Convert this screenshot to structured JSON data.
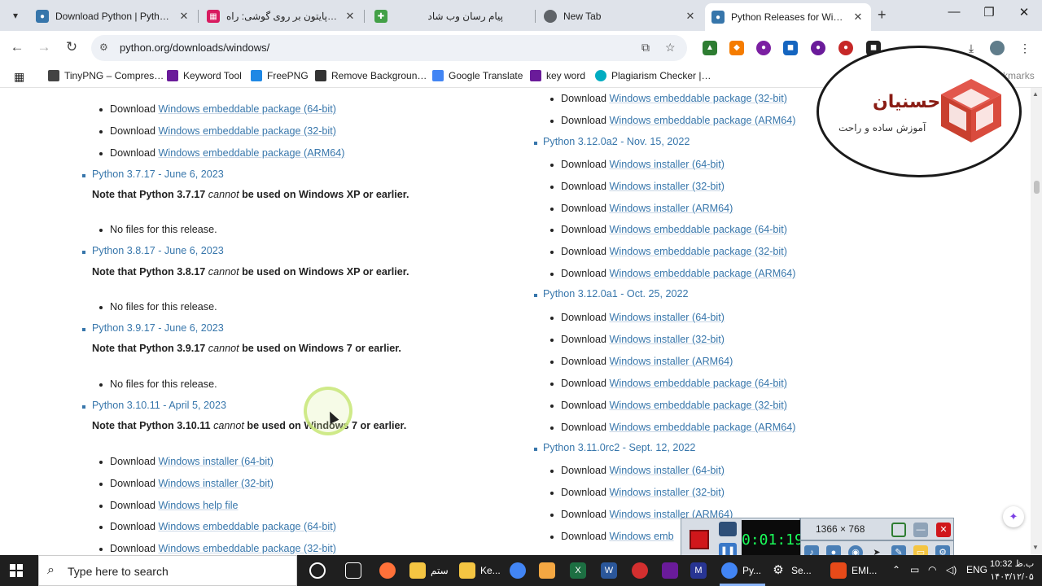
{
  "tabs": [
    {
      "title": "Download Python | Python.o",
      "icon": "python-icon",
      "color": "#3776ab"
    },
    {
      "title": "نصب پایتون بر روی گوشی: راه",
      "icon": "app-icon",
      "color": "#d81b60"
    },
    {
      "title": "",
      "icon": "game-icon",
      "color": "#43a047"
    },
    {
      "title": "پیام رسان وب شاد",
      "icon": "shad-icon",
      "color": "#fff"
    },
    {
      "title": "New Tab",
      "icon": "chrome-icon",
      "color": "#5f6368"
    },
    {
      "title": "Python Releases for Windo",
      "icon": "python-icon",
      "color": "#3776ab"
    }
  ],
  "toolbar": {
    "url": "python.org/downloads/windows/"
  },
  "bookmarks": [
    {
      "label": "TinyPNG – Compres…",
      "icon": "tinypng-icon",
      "color": "#444"
    },
    {
      "label": "Keyword Tool",
      "icon": "keyword-tool-icon",
      "color": "#6a1b9a"
    },
    {
      "label": "FreePNG",
      "icon": "freepng-icon",
      "color": "#1e88e5"
    },
    {
      "label": "Remove Backgroun…",
      "icon": "remove-bg-icon",
      "color": "#333"
    },
    {
      "label": "Google Translate",
      "icon": "translate-icon",
      "color": "#4285f4"
    },
    {
      "label": "key word",
      "icon": "keyword-icon",
      "color": "#6a1b9a"
    },
    {
      "label": "Plagiarism Checker |…",
      "icon": "plagiarism-icon",
      "color": "#00acc1"
    },
    {
      "label": "All Bookmarks",
      "icon": "folder-icon",
      "color": "#777"
    }
  ],
  "left_column": {
    "top_links": [
      {
        "prefix": "Download",
        "link": "Windows embeddable package (64-bit)"
      },
      {
        "prefix": "Download",
        "link": "Windows embeddable package (32-bit)"
      },
      {
        "prefix": "Download",
        "link": "Windows embeddable package (ARM64)"
      }
    ],
    "releases": [
      {
        "title": "Python 3.7.17 - June 6, 2023",
        "note_pre": "Note that Python 3.7.17 ",
        "note_em": "cannot",
        "note_post": " be used on Windows XP or earlier.",
        "files": "No files for this release."
      },
      {
        "title": "Python 3.8.17 - June 6, 2023",
        "note_pre": "Note that Python 3.8.17 ",
        "note_em": "cannot",
        "note_post": " be used on Windows XP or earlier.",
        "files": "No files for this release."
      },
      {
        "title": "Python 3.9.17 - June 6, 2023",
        "note_pre": "Note that Python 3.9.17 ",
        "note_em": "cannot",
        "note_post": " be used on Windows 7 or earlier.",
        "files": "No files for this release."
      },
      {
        "title": "Python 3.10.11 - April 5, 2023",
        "note_pre": "Note that Python 3.10.11 ",
        "note_em": "cannot",
        "note_post": " be used on Windows 7 or earlier.",
        "files": ""
      }
    ],
    "bottom_links": [
      {
        "prefix": "Download",
        "link": "Windows installer (64-bit)"
      },
      {
        "prefix": "Download",
        "link": "Windows installer (32-bit)"
      },
      {
        "prefix": "Download",
        "link": "Windows help file"
      },
      {
        "prefix": "Download",
        "link": "Windows embeddable package (64-bit)"
      },
      {
        "prefix": "Download",
        "link": "Windows embeddable package (32-bit)"
      }
    ]
  },
  "right_column": {
    "top_links": [
      {
        "prefix": "Download",
        "link": "Windows embeddable package (32-bit)"
      },
      {
        "prefix": "Download",
        "link": "Windows embeddable package (ARM64)"
      }
    ],
    "release_a": "Python 3.12.0a2 - Nov. 15, 2022",
    "links_a": [
      {
        "prefix": "Download",
        "link": "Windows installer (64-bit)"
      },
      {
        "prefix": "Download",
        "link": "Windows installer (32-bit)"
      },
      {
        "prefix": "Download",
        "link": "Windows installer (ARM64)"
      },
      {
        "prefix": "Download",
        "link": "Windows embeddable package (64-bit)"
      },
      {
        "prefix": "Download",
        "link": "Windows embeddable package (32-bit)"
      },
      {
        "prefix": "Download",
        "link": "Windows embeddable package (ARM64)"
      }
    ],
    "release_b": "Python 3.12.0a1 - Oct. 25, 2022",
    "links_b": [
      {
        "prefix": "Download",
        "link": "Windows installer (64-bit)"
      },
      {
        "prefix": "Download",
        "link": "Windows installer (32-bit)"
      },
      {
        "prefix": "Download",
        "link": "Windows installer (ARM64)"
      },
      {
        "prefix": "Download",
        "link": "Windows embeddable package (64-bit)"
      },
      {
        "prefix": "Download",
        "link": "Windows embeddable package (32-bit)"
      },
      {
        "prefix": "Download",
        "link": "Windows embeddable package (ARM64)"
      }
    ],
    "release_c": "Python 3.11.0rc2 - Sept. 12, 2022",
    "links_c": [
      {
        "prefix": "Download",
        "link": "Windows installer (64-bit)"
      },
      {
        "prefix": "Download",
        "link": "Windows installer (32-bit)"
      },
      {
        "prefix": "Download",
        "link": "Windows installer (ARM64)"
      },
      {
        "prefix": "Download",
        "link": "Windows emb"
      }
    ]
  },
  "watermark": {
    "name": "حسنیان",
    "tagline": "آموزش ساده و راحت",
    "color": "#d94b3d"
  },
  "recorder": {
    "dimensions": "1366 × 768",
    "timer": "0:01:19",
    "stop_color": "#d0171b"
  },
  "taskbar": {
    "search_placeholder": "Type here to search",
    "items": [
      {
        "label": "",
        "icon": "cortana-icon",
        "color": "#1f1f1f"
      },
      {
        "label": "",
        "icon": "task-view-icon",
        "color": "#1f1f1f"
      },
      {
        "label": "",
        "icon": "firefox-icon",
        "color": "#ff7139"
      },
      {
        "label": "ستم",
        "icon": "folder-icon",
        "color": "#f4c542"
      },
      {
        "label": "Ke...",
        "icon": "folder-icon",
        "color": "#f4c542"
      },
      {
        "label": "",
        "icon": "chrome-icon",
        "color": "#4285f4"
      },
      {
        "label": "",
        "icon": "video-icon",
        "color": "#f4a742"
      },
      {
        "label": "",
        "icon": "excel-icon",
        "color": "#1d6f42"
      },
      {
        "label": "",
        "icon": "word-icon",
        "color": "#2b579a"
      },
      {
        "label": "",
        "icon": "record-icon",
        "color": "#d32f2f"
      },
      {
        "label": "",
        "icon": "shield-icon",
        "color": "#6a1b9a"
      },
      {
        "label": "",
        "icon": "media-icon",
        "color": "#5e35b1"
      },
      {
        "label": "",
        "icon": "gmail-icon",
        "color": "#283593"
      },
      {
        "label": "Py...",
        "icon": "chrome-icon",
        "color": "#4285f4"
      },
      {
        "label": "Se...",
        "icon": "settings-icon",
        "color": "#1f1f1f"
      },
      {
        "label": "EMI...",
        "icon": "app-icon",
        "color": "#e64a19"
      }
    ],
    "tray_lang": "ENG",
    "clock_time": "ب.ظ 10:32",
    "clock_date": "۱۴۰۳/۱۲/۰۵"
  }
}
